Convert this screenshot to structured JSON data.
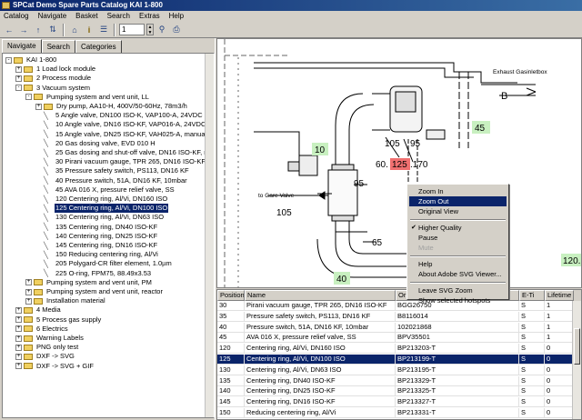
{
  "window": {
    "title": "SPCat Demo Spare Parts Catalog KAI 1-800"
  },
  "menu": [
    "Catalog",
    "Navigate",
    "Basket",
    "Search",
    "Extras",
    "Help"
  ],
  "toolbar": {
    "icons": [
      "back-icon",
      "forward-icon",
      "up-icon",
      "upup-icon",
      "home-icon",
      "info-icon",
      "list-icon",
      "print-icon",
      "zoom-icon",
      "printer-icon"
    ],
    "page_value": "1"
  },
  "tabs": [
    "Navigate",
    "Search",
    "Categories"
  ],
  "tree": [
    {
      "label": "KAI 1-800",
      "level": 0,
      "type": "folder",
      "exp": "-"
    },
    {
      "label": "1 Load lock module",
      "level": 1,
      "type": "folder",
      "exp": "+"
    },
    {
      "label": "2 Process module",
      "level": 1,
      "type": "folder",
      "exp": "+"
    },
    {
      "label": "3 Vacuum system",
      "level": 1,
      "type": "folder",
      "exp": "-"
    },
    {
      "label": "Pumping system and vent unit, LL",
      "level": 2,
      "type": "folder",
      "exp": "-"
    },
    {
      "label": "Dry pump, AA10-H, 400V/50-60Hz, 78m3/h",
      "level": 3,
      "type": "folder",
      "exp": "+"
    },
    {
      "label": "5 Angle valve, DN100 ISO-K, VAP100-A, 24VDC",
      "level": 3,
      "type": "part"
    },
    {
      "label": "10 Angle valve, DN16 ISO-KF, VAP016-A, 24VDC",
      "level": 3,
      "type": "part"
    },
    {
      "label": "15 Angle valve, DN25 ISO-KF, VAH025-A, manually op.",
      "level": 3,
      "type": "part"
    },
    {
      "label": "20 Gas dosing valve, EVD 010 H",
      "level": 3,
      "type": "part"
    },
    {
      "label": "25 Gas dosing and shut-off valve, DN16 ISO-KF, man. c",
      "level": 3,
      "type": "part"
    },
    {
      "label": "30 Pirani vacuum gauge, TPR 265, DN16 ISO-KF",
      "level": 3,
      "type": "part"
    },
    {
      "label": "35 Pressure safety switch, PS113, DN16 KF",
      "level": 3,
      "type": "part"
    },
    {
      "label": "40 Pressure switch, 51A, DN16 KF, 10mbar",
      "level": 3,
      "type": "part"
    },
    {
      "label": "45 AVA 016 X, pressure relief valve, SS",
      "level": 3,
      "type": "part"
    },
    {
      "label": "120 Centering ring, Al/Vi, DN160 ISO",
      "level": 3,
      "type": "part"
    },
    {
      "label": "125 Centering ring, Al/Vi, DN100 ISO",
      "level": 3,
      "type": "part",
      "selected": true
    },
    {
      "label": "130 Centering ring, Al/Vi, DN63 ISO",
      "level": 3,
      "type": "part"
    },
    {
      "label": "135 Centering ring, DN40 ISO-KF",
      "level": 3,
      "type": "part"
    },
    {
      "label": "140 Centering ring, DN25 ISO-KF",
      "level": 3,
      "type": "part"
    },
    {
      "label": "145 Centering ring, DN16 ISO-KF",
      "level": 3,
      "type": "part"
    },
    {
      "label": "150 Reducing centering ring, Al/Vi",
      "level": 3,
      "type": "part"
    },
    {
      "label": "205 Polygard-CR filter element, 1.0µm",
      "level": 3,
      "type": "part"
    },
    {
      "label": "225 O-ring, FPM75, 88.49x3.53",
      "level": 3,
      "type": "part"
    },
    {
      "label": "Pumping system and vent unit, PM",
      "level": 2,
      "type": "folder",
      "exp": "+"
    },
    {
      "label": "Pumping system and vent unit, reactor",
      "level": 2,
      "type": "folder",
      "exp": "+"
    },
    {
      "label": "Installation material",
      "level": 2,
      "type": "folder",
      "exp": "+"
    },
    {
      "label": "4 Media",
      "level": 1,
      "type": "folder",
      "exp": "+"
    },
    {
      "label": "5 Process gas supply",
      "level": 1,
      "type": "folder",
      "exp": "+"
    },
    {
      "label": "6 Electrics",
      "level": 1,
      "type": "folder",
      "exp": "+"
    },
    {
      "label": "Warning Labels",
      "level": 1,
      "type": "folder",
      "exp": "+"
    },
    {
      "label": "PNG only test",
      "level": 1,
      "type": "folder",
      "exp": "+"
    },
    {
      "label": "DXF -> SVG",
      "level": 1,
      "type": "folder",
      "exp": "+"
    },
    {
      "label": "DXF -> SVG + GIF",
      "level": 1,
      "type": "folder",
      "exp": "+"
    }
  ],
  "drawing": {
    "labels": [
      "Exhaust Gasinletbox",
      "B",
      "45",
      "10",
      "105",
      "95",
      "60.",
      "125",
      ".170",
      "95",
      "to Gare Valve",
      "105",
      "65",
      "40",
      "120."
    ]
  },
  "context_menu": {
    "items": [
      {
        "label": "Zoom In"
      },
      {
        "label": "Zoom Out",
        "highlight": true
      },
      {
        "label": "Original View"
      },
      {
        "sep": true
      },
      {
        "label": "Higher Quality",
        "checked": true
      },
      {
        "label": "Pause"
      },
      {
        "label": "Mute",
        "disabled": true
      },
      {
        "sep": true
      },
      {
        "label": "Help"
      },
      {
        "label": "About Adobe SVG Viewer..."
      },
      {
        "sep": true
      },
      {
        "label": "Leave SVG Zoom"
      },
      {
        "label": "Show selected hotspots"
      }
    ]
  },
  "table": {
    "columns": [
      "Position",
      "Name",
      "Or",
      "E-Ti",
      "Lifetime"
    ],
    "rows": [
      [
        "30",
        "Pirani vacuum gauge, TPR 265, DN16 ISO-KF",
        "BGG26750",
        "S",
        "1"
      ],
      [
        "35",
        "Pressure safety switch, PS113, DN16 KF",
        "B8116014",
        "S",
        "1"
      ],
      [
        "40",
        "Pressure switch, 51A, DN16 KF, 10mbar",
        "102021868",
        "S",
        "1"
      ],
      [
        "45",
        "AVA 016 X, pressure relief valve, SS",
        "BPV35501",
        "S",
        "1"
      ],
      [
        "120",
        "Centering ring, Al/Vi, DN160 ISO",
        "BP213203-T",
        "S",
        "0"
      ],
      [
        "125",
        "Centering ring, Al/Vi, DN100 ISO",
        "BP213199-T",
        "S",
        "0"
      ],
      [
        "130",
        "Centering ring, Al/Vi, DN63 ISO",
        "BP213195-T",
        "S",
        "0"
      ],
      [
        "135",
        "Centering ring, DN40 ISO-KF",
        "BP213329-T",
        "S",
        "0"
      ],
      [
        "140",
        "Centering ring, DN25 ISO-KF",
        "BP213325-T",
        "S",
        "0"
      ],
      [
        "145",
        "Centering ring, DN16 ISO-KF",
        "BP213327-T",
        "S",
        "0"
      ],
      [
        "150",
        "Reducing centering ring, Al/Vi",
        "BP213331-T",
        "S",
        "0"
      ]
    ],
    "selected_index": 5
  },
  "colors": {
    "selection": "#0a246a",
    "hotspot_green": "#c8f0c0",
    "hotspot_red": "#f07070"
  }
}
